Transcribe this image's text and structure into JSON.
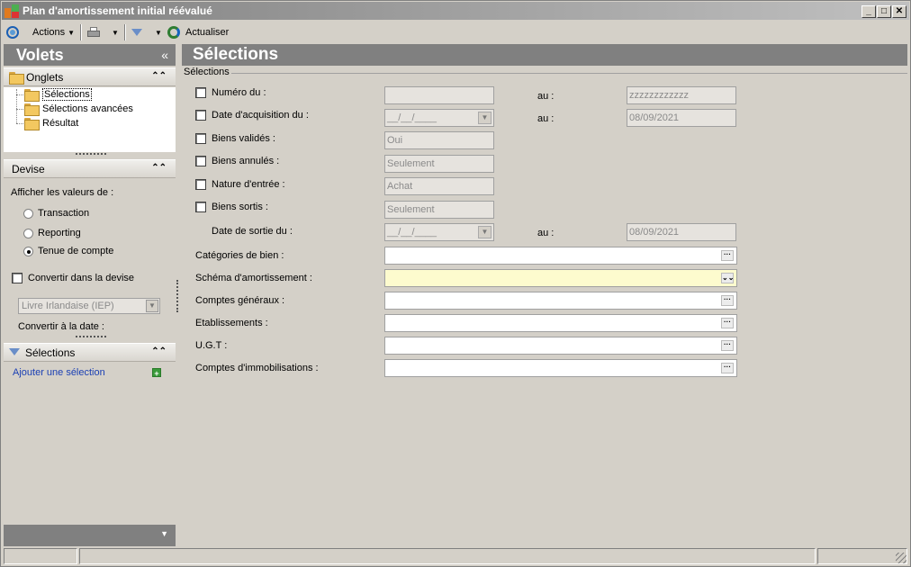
{
  "window": {
    "title": "Plan d'amortissement initial réévalué",
    "minimize": "_",
    "maximize": "□",
    "close": "✕"
  },
  "toolbar": {
    "actions_label": "Actions",
    "refresh_label": "Actualiser"
  },
  "left_panel": {
    "title": "Volets",
    "collapse_glyph": "«",
    "onglets": {
      "title": "Onglets",
      "items": [
        {
          "label": "Sélections"
        },
        {
          "label": "Sélections avancées"
        },
        {
          "label": "Résultat"
        }
      ]
    },
    "devise": {
      "title": "Devise",
      "prompt": "Afficher les valeurs de :",
      "options": [
        {
          "label": "Transaction",
          "selected": false
        },
        {
          "label": "Reporting",
          "selected": false
        },
        {
          "label": "Tenue de compte",
          "selected": true
        }
      ],
      "convert_label": "Convertir dans la devise",
      "currency_value": "Livre Irlandaise (IEP)",
      "convert_date_label": "Convertir à la date :"
    },
    "selections": {
      "title": "Sélections",
      "add_link": "Ajouter une sélection",
      "add_glyph": "+"
    }
  },
  "main": {
    "title": "Sélections",
    "group_label": "Sélections",
    "au_label": "au :",
    "rows": {
      "numero": {
        "label": "Numéro du :",
        "from": "",
        "to": "zzzzzzzzzzzz"
      },
      "acquisition": {
        "label": "Date d'acquisition du :",
        "from": "__/__/____",
        "to": "08/09/2021"
      },
      "valides": {
        "label": "Biens validés :",
        "value": "Oui"
      },
      "annules": {
        "label": "Biens annulés :",
        "value": "Seulement"
      },
      "nature": {
        "label": "Nature d'entrée :",
        "value": "Achat"
      },
      "sortis": {
        "label": "Biens sortis :",
        "value": "Seulement"
      },
      "sortie_date": {
        "label": "Date de sortie du :",
        "from": "__/__/____",
        "to": "08/09/2021"
      },
      "categories": {
        "label": "Catégories de bien :",
        "value": ""
      },
      "schema": {
        "label": "Schéma d'amortissement :",
        "value": ""
      },
      "comptes_generaux": {
        "label": "Comptes généraux :",
        "value": ""
      },
      "etablissements": {
        "label": "Etablissements :",
        "value": ""
      },
      "ugt": {
        "label": "U.G.T :",
        "value": ""
      },
      "comptes_immo": {
        "label": "Comptes d'immobilisations :",
        "value": ""
      }
    }
  }
}
